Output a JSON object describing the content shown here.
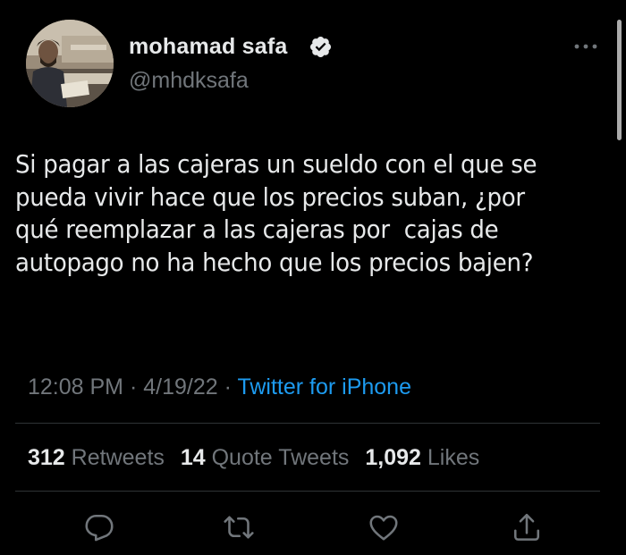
{
  "author": {
    "display_name": "mohamad safa",
    "handle": "@mhdksafa",
    "verified": true
  },
  "tweet": {
    "text": "Si pagar a las cajeras un sueldo con el que se\npueda vivir hace que los precios suban, ¿por\nqué reemplazar a las cajeras por  cajas de\nautopago no ha hecho que los precios bajen?"
  },
  "meta": {
    "time": "12:08 PM",
    "separator": "·",
    "date": "4/19/22",
    "source": "Twitter for iPhone"
  },
  "stats": {
    "retweets_count": "312",
    "retweets_label": "Retweets",
    "quote_count": "14",
    "quote_label": "Quote Tweets",
    "likes_count": "1,092",
    "likes_label": "Likes"
  },
  "actions": [
    "reply-icon",
    "retweet-icon",
    "like-icon",
    "share-icon"
  ],
  "colors": {
    "background": "#000000",
    "text": "#e7e9ea",
    "secondary": "#71767b",
    "link": "#1d9bf0",
    "divider": "#2f3336"
  }
}
